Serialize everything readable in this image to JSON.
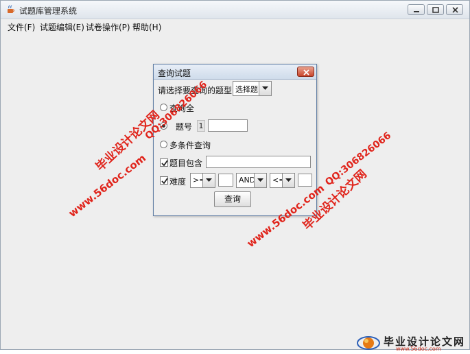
{
  "window": {
    "title": "试题库管理系统"
  },
  "menu": [
    {
      "label": "文件(F)"
    },
    {
      "label": "试题编辑(E)"
    },
    {
      "label": "试卷操作(P)"
    },
    {
      "label": "帮助(H)"
    }
  ],
  "dialog": {
    "title": "查询试题",
    "type_prompt": "请选择要查询的题型:",
    "type_selected": "选择题",
    "radio_all": "查询全",
    "radio_id": "题号",
    "id_spinner": "1",
    "radio_multi": "多条件查询",
    "check_content": "题目包含",
    "check_difficulty": "难度",
    "op1": ">=",
    "logic": "AND",
    "op2": "<=",
    "query_button": "查询"
  },
  "watermark": {
    "site_name": "毕业设计论文网",
    "url": "www.56doc.com",
    "qq": "QQ:306826066"
  },
  "logo": {
    "text": "毕业设计论文网",
    "url": "www.56doc.com"
  },
  "colors": {
    "watermark_red": "#e0241b",
    "watermark_blue": "#2850b8",
    "dialog_close": "#c8452c"
  }
}
